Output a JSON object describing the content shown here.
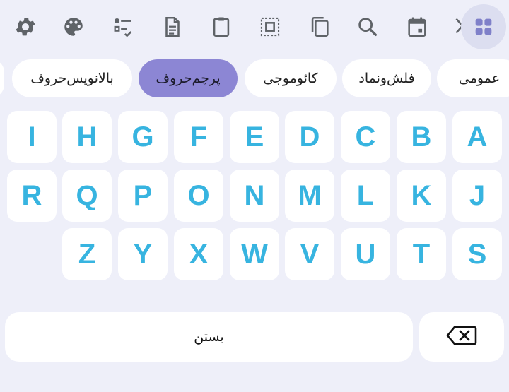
{
  "toolbar": {
    "icons": [
      "settings-icon",
      "palette-icon",
      "checklist-icon",
      "document-icon",
      "clipboard-icon",
      "select-all-icon",
      "copy-icon",
      "search-icon",
      "calendar-icon",
      "cut-icon",
      "apps-grid-icon"
    ],
    "active_icon": "apps-grid-icon"
  },
  "categories": {
    "items": [
      "عمومی",
      "فلش‌ونماد",
      "کائوموجی",
      "پرچم‌حروف",
      "بالانویس‌حروف"
    ],
    "selected": "پرچم‌حروف"
  },
  "keyboard": {
    "row1": [
      "I",
      "H",
      "G",
      "F",
      "E",
      "D",
      "C",
      "B",
      "A"
    ],
    "row2": [
      "R",
      "Q",
      "P",
      "O",
      "N",
      "M",
      "L",
      "K",
      "J"
    ],
    "row3": [
      "Z",
      "Y",
      "X",
      "W",
      "V",
      "U",
      "T",
      "S"
    ],
    "space_label": "بستن",
    "backspace_icon": "backspace-icon"
  },
  "colors": {
    "background": "#eeeff9",
    "key": "#ffffff",
    "letter": "#37b4e0",
    "chip_selected": "#8c86d4",
    "icon": "#5f6368"
  }
}
